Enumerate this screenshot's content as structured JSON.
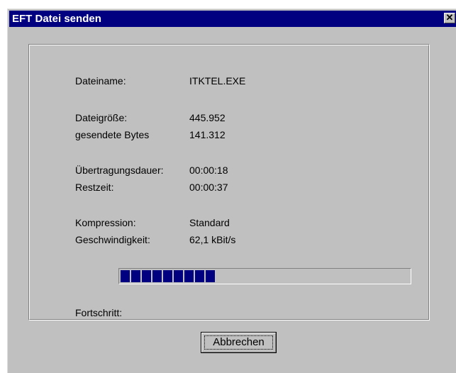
{
  "window": {
    "title": "EFT Datei senden",
    "close_glyph": "✕"
  },
  "details": {
    "filename_label": "Dateiname:",
    "filename_value": "ITKTEL.EXE",
    "filesize_label": "Dateigröße:",
    "filesize_value": "445.952",
    "sent_label": "gesendete Bytes",
    "sent_value": "141.312",
    "duration_label": "Übertragungsdauer:",
    "duration_value": "00:00:18",
    "remaining_label": "Restzeit:",
    "remaining_value": "00:00:37",
    "compression_label": "Kompression:",
    "compression_value": "Standard",
    "speed_label": "Geschwindigkeit:",
    "speed_value": "62,1 kBit/s"
  },
  "progress": {
    "label": "Fortschritt:",
    "fraction": 0.317,
    "color": "#000080"
  },
  "buttons": {
    "cancel_label": "Abbrechen"
  },
  "colors": {
    "titlebar": "#000080",
    "face": "#c0c0c0"
  }
}
